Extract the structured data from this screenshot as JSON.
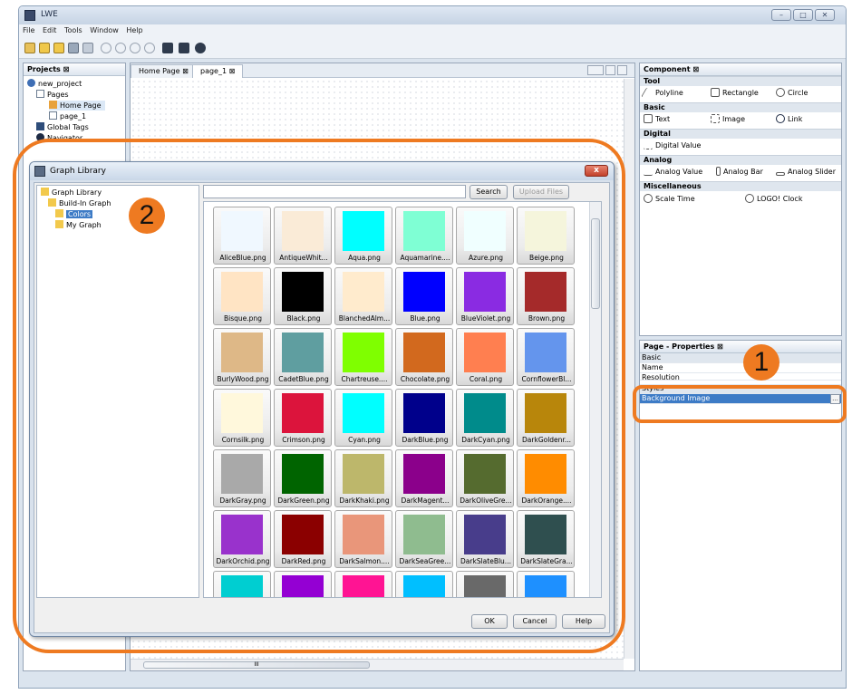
{
  "window": {
    "title": "LWE",
    "btn_minimize": "–",
    "btn_maximize": "□",
    "btn_close": "✕"
  },
  "menu": [
    "File",
    "Edit",
    "Tools",
    "Window",
    "Help"
  ],
  "projects": {
    "header": "Projects ⊠",
    "tree": [
      {
        "label": "new_project",
        "level": 0
      },
      {
        "label": "Pages",
        "level": 1
      },
      {
        "label": "Home Page",
        "level": 2
      },
      {
        "label": "page_1",
        "level": 2
      },
      {
        "label": "Global Tags",
        "level": 1
      },
      {
        "label": "Navigator",
        "level": 1
      }
    ]
  },
  "editor": {
    "tabs": [
      "Home Page ⊠",
      "page_1 ⊠"
    ]
  },
  "component": {
    "header": "Component ⊠",
    "categories": {
      "tool": "Tool",
      "basic": "Basic",
      "digital": "Digital",
      "analog": "Analog",
      "misc": "Miscellaneous"
    },
    "items": {
      "polyline": "Polyline",
      "rectangle": "Rectangle",
      "circle": "Circle",
      "text": "Text",
      "image": "Image",
      "link": "Link",
      "digital_value": "Digital Value",
      "analog_value": "Analog Value",
      "analog_bar": "Analog Bar",
      "analog_slider": "Analog Slider",
      "scale_time": "Scale Time",
      "logo_clock": "LOGO! Clock"
    }
  },
  "properties": {
    "header": "Page - Properties ⊠",
    "basic": "Basic",
    "name": "Name",
    "resolution": "Resolution",
    "styles": "Styles",
    "background_image": "Background Image",
    "ellipsis": "..."
  },
  "dialog": {
    "title": "Graph Library",
    "close": "x",
    "tree": [
      {
        "label": "Graph Library"
      },
      {
        "label": "Build-In Graph"
      },
      {
        "label": "Colors"
      },
      {
        "label": "My Graph"
      }
    ],
    "search_placeholder": "",
    "search_button": "Search",
    "upload_button": "Upload Files",
    "ok": "OK",
    "cancel": "Cancel",
    "help": "Help",
    "thumbs": [
      {
        "label": "AliceBlue.png",
        "color": "#F0F8FF"
      },
      {
        "label": "AntiqueWhit...",
        "color": "#FAEBD7"
      },
      {
        "label": "Aqua.png",
        "color": "#00FFFF"
      },
      {
        "label": "Aquamarine....",
        "color": "#7FFFD4"
      },
      {
        "label": "Azure.png",
        "color": "#F0FFFF"
      },
      {
        "label": "Beige.png",
        "color": "#F5F5DC"
      },
      {
        "label": "Bisque.png",
        "color": "#FFE4C4"
      },
      {
        "label": "Black.png",
        "color": "#000000"
      },
      {
        "label": "BlanchedAlm...",
        "color": "#FFEBCD"
      },
      {
        "label": "Blue.png",
        "color": "#0000FF"
      },
      {
        "label": "BlueViolet.png",
        "color": "#8A2BE2"
      },
      {
        "label": "Brown.png",
        "color": "#A52A2A"
      },
      {
        "label": "BurlyWood.png",
        "color": "#DEB887"
      },
      {
        "label": "CadetBlue.png",
        "color": "#5F9EA0"
      },
      {
        "label": "Chartreuse....",
        "color": "#7FFF00"
      },
      {
        "label": "Chocolate.png",
        "color": "#D2691E"
      },
      {
        "label": "Coral.png",
        "color": "#FF7F50"
      },
      {
        "label": "CornflowerBl...",
        "color": "#6495ED"
      },
      {
        "label": "Cornsilk.png",
        "color": "#FFF8DC"
      },
      {
        "label": "Crimson.png",
        "color": "#DC143C"
      },
      {
        "label": "Cyan.png",
        "color": "#00FFFF"
      },
      {
        "label": "DarkBlue.png",
        "color": "#00008B"
      },
      {
        "label": "DarkCyan.png",
        "color": "#008B8B"
      },
      {
        "label": "DarkGoldenr...",
        "color": "#B8860B"
      },
      {
        "label": "DarkGray.png",
        "color": "#A9A9A9"
      },
      {
        "label": "DarkGreen.png",
        "color": "#006400"
      },
      {
        "label": "DarkKhaki.png",
        "color": "#BDB76B"
      },
      {
        "label": "DarkMagent...",
        "color": "#8B008B"
      },
      {
        "label": "DarkOliveGre...",
        "color": "#556B2F"
      },
      {
        "label": "DarkOrange....",
        "color": "#FF8C00"
      },
      {
        "label": "DarkOrchid.png",
        "color": "#9932CC"
      },
      {
        "label": "DarkRed.png",
        "color": "#8B0000"
      },
      {
        "label": "DarkSalmon....",
        "color": "#E9967A"
      },
      {
        "label": "DarkSeaGree...",
        "color": "#8FBC8F"
      },
      {
        "label": "DarkSlateBlu...",
        "color": "#483D8B"
      },
      {
        "label": "DarkSlateGra...",
        "color": "#2F4F4F"
      },
      {
        "label": "",
        "color": "#00CED1"
      },
      {
        "label": "",
        "color": "#9400D3"
      },
      {
        "label": "",
        "color": "#FF1493"
      },
      {
        "label": "",
        "color": "#00BFFF"
      },
      {
        "label": "",
        "color": "#696969"
      },
      {
        "label": "",
        "color": "#1E90FF"
      }
    ]
  },
  "callouts": {
    "one": "1",
    "two": "2",
    "color": "#EE7A21"
  },
  "h_scroll_label": "III"
}
